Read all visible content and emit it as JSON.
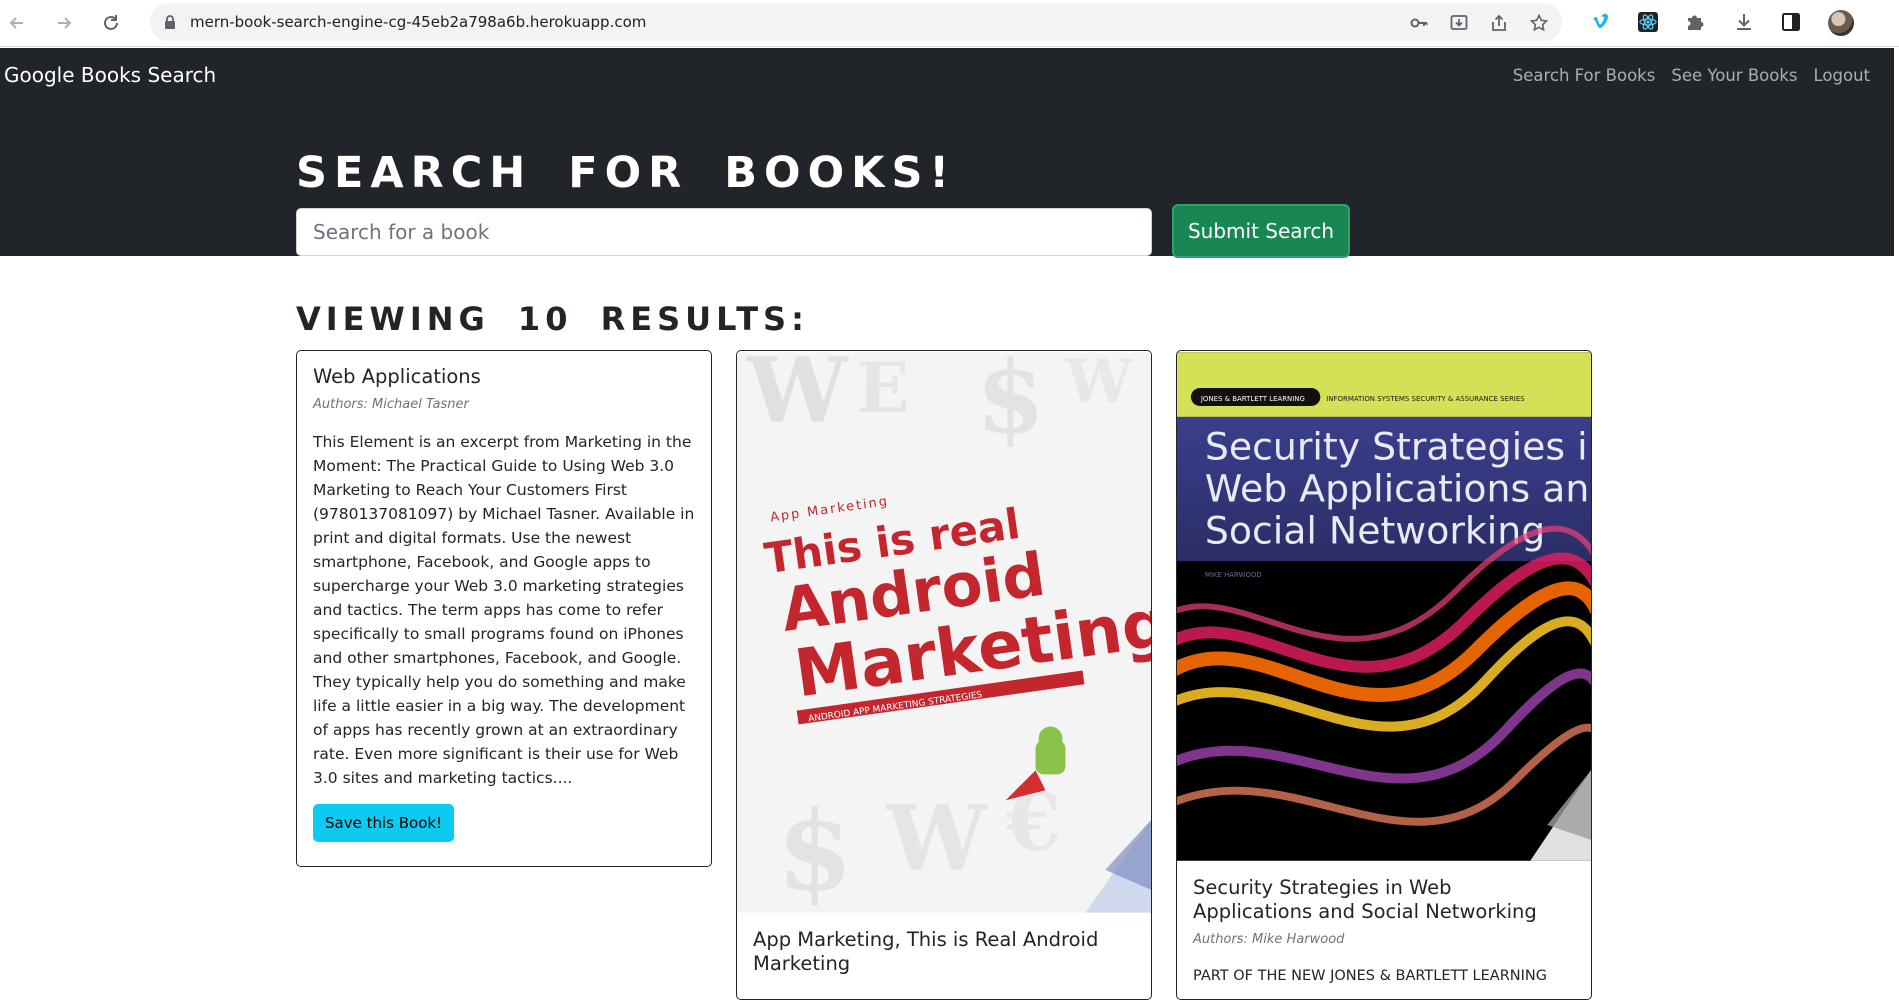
{
  "browser": {
    "url": "mern-book-search-engine-cg-45eb2a798a6b.herokuapp.com"
  },
  "navbar": {
    "brand": "Google Books Search",
    "links": [
      "Search For Books",
      "See Your Books",
      "Logout"
    ]
  },
  "hero": {
    "title": "SEARCH FOR BOOKS!",
    "search_placeholder": "Search for a book",
    "search_value": "",
    "submit_label": "Submit Search"
  },
  "results": {
    "heading": "VIEWING 10 RESULTS:",
    "books": [
      {
        "title": "Web Applications",
        "authors": "Authors: Michael Tasner",
        "description": "This Element is an excerpt from Marketing in the Moment: The Practical Guide to Using Web 3.0 Marketing to Reach Your Customers First (9780137081097) by Michael Tasner. Available in print and digital formats. Use the newest smartphone, Facebook, and Google apps to supercharge your Web 3.0 marketing strategies and tactics. The term apps has come to refer specifically to small programs found on iPhones and other smartphones, Facebook, and Google. They typically help you do something and make life a little easier in a big way. The development of apps has recently grown at an extraordinary rate. Even more significant is their use for Web 3.0 sites and marketing tactics....",
        "save_label": "Save this Book!"
      },
      {
        "title": "App Marketing, This is Real Android Marketing",
        "cover_text": {
          "tag": "App Marketing",
          "line1": "This is real",
          "line2": "Android",
          "line3": "Marketing",
          "sub": "ANDROID APP MARKETING STRATEGIES"
        }
      },
      {
        "title": "Security Strategies in Web Applications and Social Networking",
        "authors": "Authors: Mike Harwood",
        "description_start": "PART OF THE NEW JONES & BARTLETT LEARNING",
        "cover_text": {
          "publisher": "JONES & BARTLETT LEARNING",
          "series": "INFORMATION SYSTEMS SECURITY & ASSURANCE SERIES",
          "line1": "Security Strategies in",
          "line2": "Web Applications and",
          "line3": "Social Networking",
          "author": "MIKE HARWOOD"
        }
      }
    ]
  }
}
